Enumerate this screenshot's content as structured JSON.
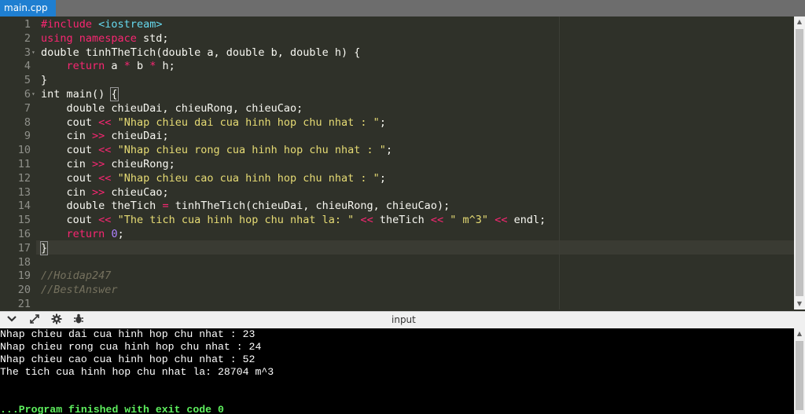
{
  "tab": {
    "label": "main.cpp"
  },
  "editor": {
    "line_numbers": [
      "1",
      "2",
      "3",
      "4",
      "5",
      "6",
      "7",
      "8",
      "9",
      "10",
      "11",
      "12",
      "13",
      "14",
      "15",
      "16",
      "17",
      "18",
      "19",
      "20",
      "21"
    ],
    "active_line": 17
  },
  "code": {
    "l1": {
      "a": "#include",
      "b": " ",
      "c": "<iostream>"
    },
    "l2": {
      "a": "using namespace",
      "b": " std;"
    },
    "l3": "double tinhTheTich(double a, double b, double h) {",
    "l4": {
      "a": "    ",
      "ret": "return",
      "b": " a ",
      "op1": "*",
      "c": " b ",
      "op2": "*",
      "d": " h;"
    },
    "l5": "}",
    "l6": {
      "a": "int main() ",
      "brace": "{"
    },
    "l7": "    double chieuDai, chieuRong, chieuCao;",
    "l8": {
      "a": "    cout ",
      "op": "<<",
      "b": " ",
      "str": "\"Nhap chieu dai cua hinh hop chu nhat : \"",
      "c": ";"
    },
    "l9": {
      "a": "    cin ",
      "op": ">>",
      "b": " chieuDai;"
    },
    "l10": {
      "a": "    cout ",
      "op": "<<",
      "b": " ",
      "str": "\"Nhap chieu rong cua hinh hop chu nhat : \"",
      "c": ";"
    },
    "l11": {
      "a": "    cin ",
      "op": ">>",
      "b": " chieuRong;"
    },
    "l12": {
      "a": "    cout ",
      "op": "<<",
      "b": " ",
      "str": "\"Nhap chieu cao cua hinh hop chu nhat : \"",
      "c": ";"
    },
    "l13": {
      "a": "    cin ",
      "op": ">>",
      "b": " chieuCao;"
    },
    "l14": {
      "a": "    double theTich ",
      "op": "=",
      "b": " tinhTheTich(chieuDai, chieuRong, chieuCao);"
    },
    "l15": {
      "a": "    cout ",
      "op1": "<<",
      "b": " ",
      "str1": "\"The tich cua hinh hop chu nhat la: \"",
      "c": " ",
      "op2": "<<",
      "d": " theTich ",
      "op3": "<<",
      "e": " ",
      "str2": "\" m^3\"",
      "f": " ",
      "op4": "<<",
      "g": " endl;"
    },
    "l16": {
      "a": "    ",
      "ret": "return",
      "b": " ",
      "num": "0",
      "c": ";"
    },
    "l17": {
      "brace": "}"
    },
    "l18": "",
    "l19": "//Hoidap247",
    "l20": "//BestAnswer",
    "l21": ""
  },
  "io_toolbar": {
    "label": "input",
    "icons": [
      "chevron-down-icon",
      "expand-icon",
      "gear-icon",
      "debug-icon"
    ]
  },
  "console": {
    "lines": [
      "Nhap chieu dai cua hinh hop chu nhat : 23",
      "Nhap chieu rong cua hinh hop chu nhat : 24",
      "Nhap chieu cao cua hinh hop chu nhat : 52",
      "The tich cua hinh hop chu nhat la: 28704 m^3"
    ],
    "finished": "...Program finished with exit code 0"
  },
  "colors": {
    "editor_bg": "#2f3129",
    "tab_active": "#1f7fd1",
    "keyword": "#f92672",
    "string": "#e6db74",
    "comment": "#75715e",
    "number": "#ae81ff",
    "console_finished": "#5ef05e"
  }
}
